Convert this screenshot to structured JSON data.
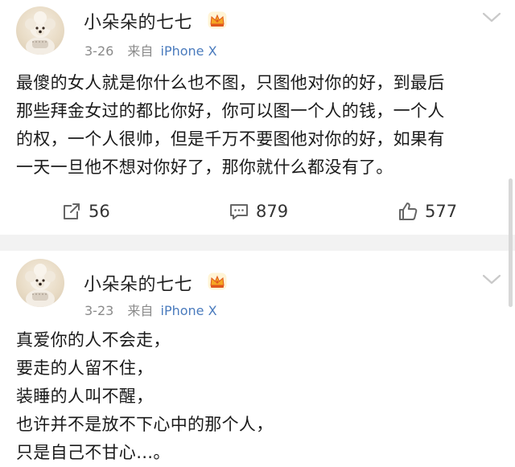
{
  "colors": {
    "username": "#222222",
    "meta_text": "#8a8a8a",
    "device_link": "#4a7bbd",
    "separator": "#f2f2f2",
    "vip_crown": "#f5a623"
  },
  "posts": [
    {
      "username": "小朵朵的七七",
      "vip_icon": "crown-vip-icon",
      "date": "3-26",
      "source_prefix": "来自",
      "device": "iPhone X",
      "content_lines": [
        "最傻的女人就是你什么也不图，只图他对你的好，到最后",
        "那些拜金女过的都比你好，你可以图一个人的钱，一个人",
        "的权，一个人很帅，但是千万不要图他对你的好，如果有",
        "一天一旦他不想对你好了，那你就什么都没有了。"
      ],
      "actions": {
        "repost_count": "56",
        "comment_count": "879",
        "like_count": "577"
      }
    },
    {
      "username": "小朵朵的七七",
      "vip_icon": "crown-vip-icon",
      "date": "3-23",
      "source_prefix": "来自",
      "device": "iPhone X",
      "content_lines": [
        "真爱你的人不会走，",
        "要走的人留不住，",
        "装睡的人叫不醒，",
        "也许并不是放不下心中的那个人，",
        "只是自己不甘心…。"
      ]
    }
  ]
}
